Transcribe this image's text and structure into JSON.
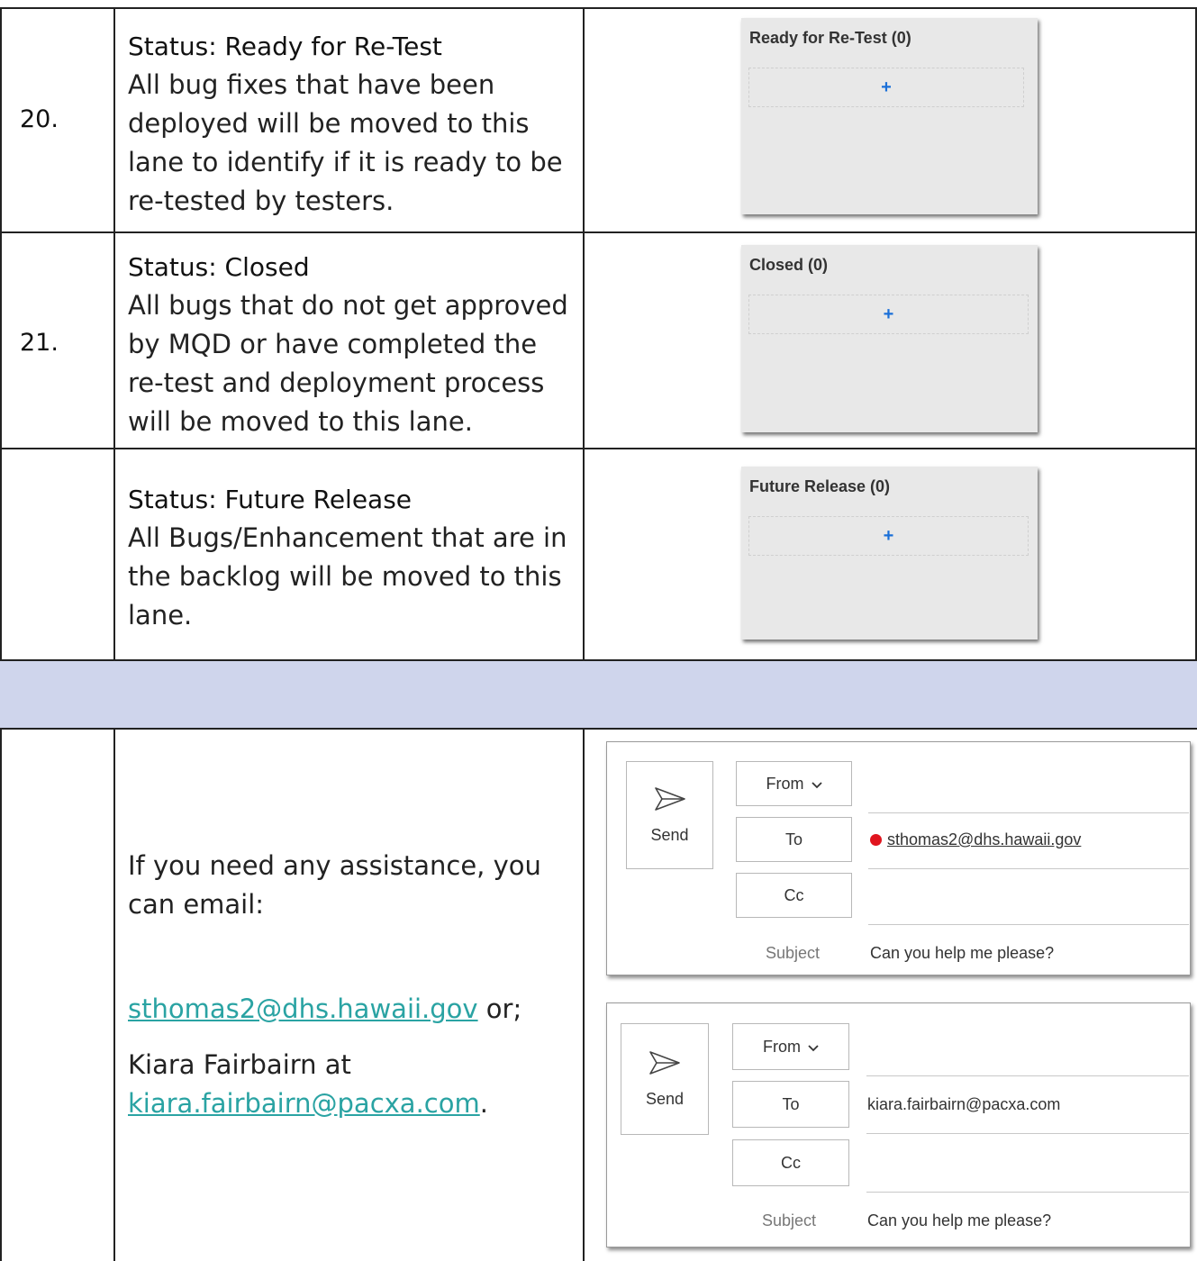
{
  "rows": [
    {
      "number": "20.",
      "title": "Status: Ready for Re-Test",
      "description": "All bug fixes that have been deployed will be moved to this lane to identify if it is ready to be re-tested by testers.",
      "lane_title": "Ready for Re-Test (0)",
      "lane_add": "+"
    },
    {
      "number": "21.",
      "title": "Status: Closed",
      "description": "All bugs that do not get approved by MQD or have completed the re-test and deployment process will be moved to this lane.",
      "lane_title": "Closed (0)",
      "lane_add": "+"
    },
    {
      "number": "",
      "title": "Status: Future Release",
      "description": "All Bugs/Enhancement that are in the backlog will be moved to this lane.",
      "lane_title": "Future Release (0)",
      "lane_add": "+"
    }
  ],
  "contact": {
    "intro": "If you need any assistance, you can email:",
    "email1": "sthomas2@dhs.hawaii.gov",
    "or": " or;",
    "name2": "Kiara Fairbairn at",
    "email2": "kiara.fairbairn@pacxa.com",
    "period": "."
  },
  "email_forms": [
    {
      "send_label": "Send",
      "from_label": "From",
      "to_label": "To",
      "cc_label": "Cc",
      "subject_label": "Subject",
      "to_value": "sthomas2@dhs.hawaii.gov",
      "subject_value": "Can you help me please?"
    },
    {
      "send_label": "Send",
      "from_label": "From",
      "to_label": "To",
      "cc_label": "Cc",
      "subject_label": "Subject",
      "to_value": "kiara.fairbairn@pacxa.com",
      "subject_value": "Can you help me please?"
    }
  ],
  "colors": {
    "band": "#cfd5ec",
    "link": "#2aa3a3",
    "lane_bg": "#e8e8e8",
    "lane_add": "#1a6fd8",
    "recipient_dot": "#e0141e"
  }
}
